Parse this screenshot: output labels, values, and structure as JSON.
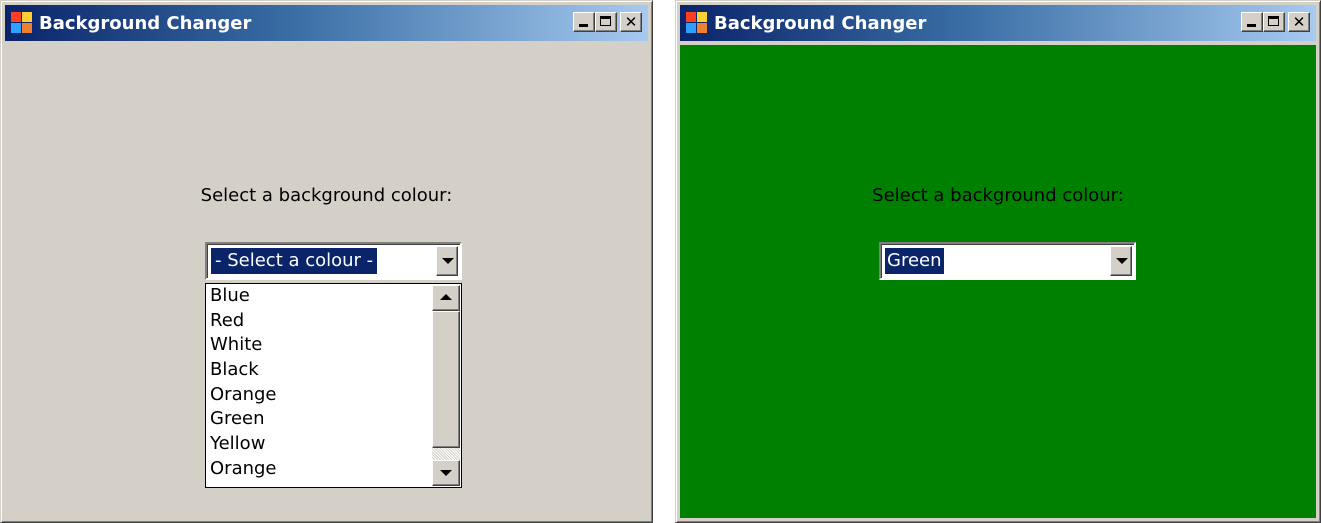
{
  "windows": [
    {
      "title": "Background Changer",
      "background_color": "#d4d0c8",
      "prompt": "Select a background colour:",
      "combo": {
        "value": "- Select a colour -",
        "expanded": true
      },
      "dropdown_items": [
        "Blue",
        "Red",
        "White",
        "Black",
        "Orange",
        "Green",
        "Yellow",
        "Orange"
      ],
      "icons": [
        "app-icon",
        "minimize-icon",
        "maximize-icon",
        "close-icon",
        "chevron-down-icon",
        "scroll-up-icon",
        "scroll-down-icon"
      ]
    },
    {
      "title": "Background Changer",
      "background_color": "#008000",
      "prompt": "Select a background colour:",
      "combo": {
        "value": "Green",
        "expanded": false
      },
      "icons": [
        "app-icon",
        "minimize-icon",
        "maximize-icon",
        "close-icon",
        "chevron-down-icon"
      ]
    }
  ],
  "colors": {
    "titlebar_start": "#0a246a",
    "titlebar_end": "#a6caf0",
    "selection": "#0a246a"
  },
  "glyphs": {
    "close": "✕"
  }
}
